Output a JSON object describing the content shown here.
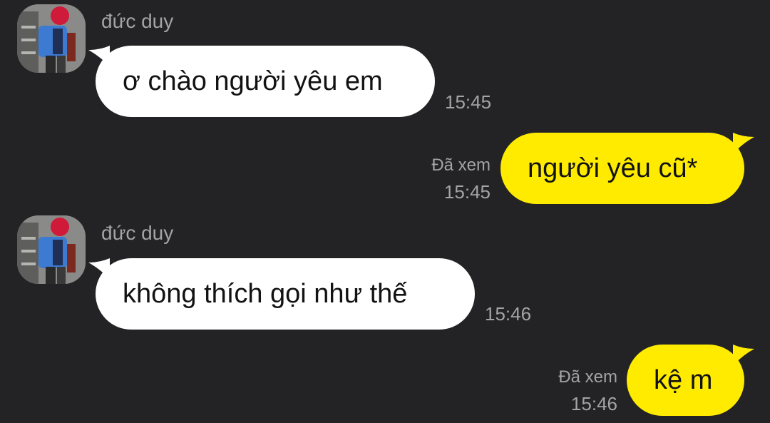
{
  "colors": {
    "background": "#232325",
    "incoming_bubble": "#ffffff",
    "outgoing_bubble": "#ffeb00",
    "meta_text": "#a3a3a8"
  },
  "messages": [
    {
      "direction": "in",
      "sender": "đức duy",
      "text": "ơ chào người yêu em",
      "time": "15:45",
      "avatar_icon": "user-photo-icon"
    },
    {
      "direction": "out",
      "status": "Đã xem",
      "text": "người yêu cũ*",
      "time": "15:45"
    },
    {
      "direction": "in",
      "sender": "đức duy",
      "text": "không thích gọi như thế",
      "time": "15:46",
      "avatar_icon": "user-photo-icon"
    },
    {
      "direction": "out",
      "status": "Đã xem",
      "text": "kệ m",
      "time": "15:46"
    }
  ]
}
